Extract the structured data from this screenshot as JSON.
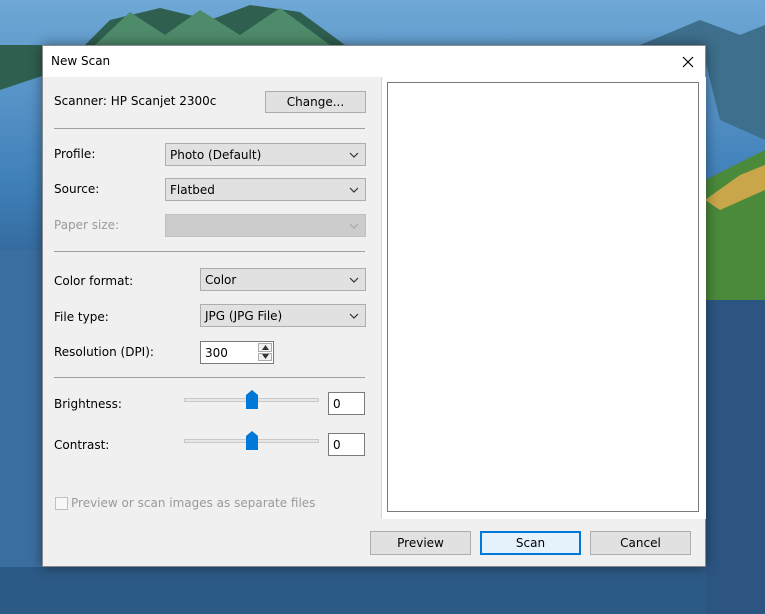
{
  "dialog": {
    "title": "New Scan",
    "scanner_label": "Scanner: HP Scanjet 2300c",
    "change_button": "Change..."
  },
  "fields": {
    "profile": {
      "label": "Profile:",
      "value": "Photo (Default)"
    },
    "source": {
      "label": "Source:",
      "value": "Flatbed"
    },
    "paper_size": {
      "label": "Paper size:",
      "value": ""
    },
    "color_format": {
      "label": "Color format:",
      "value": "Color"
    },
    "file_type": {
      "label": "File type:",
      "value": "JPG (JPG File)"
    },
    "resolution": {
      "label": "Resolution (DPI):",
      "value": "300"
    },
    "brightness": {
      "label": "Brightness:",
      "value": "0",
      "level": 0.5
    },
    "contrast": {
      "label": "Contrast:",
      "value": "0",
      "level": 0.5
    }
  },
  "separate_files": {
    "label": "Preview or scan images as separate files",
    "checked": false
  },
  "buttons": {
    "preview": "Preview",
    "scan": "Scan",
    "cancel": "Cancel"
  },
  "colors": {
    "accent": "#0078d7",
    "dialog_bg": "#f0f0f0"
  }
}
